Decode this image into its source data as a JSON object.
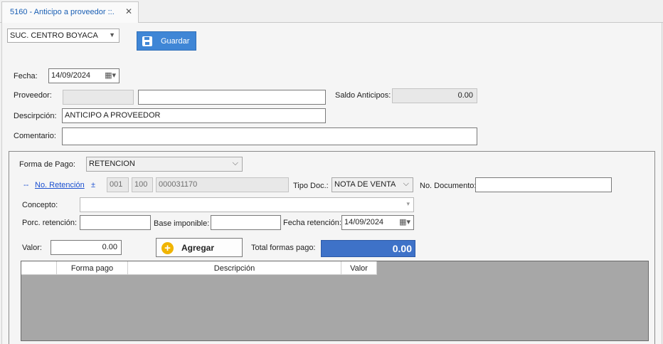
{
  "tab": {
    "title": "5160 - Anticipo a proveedor ::.",
    "close": "✕"
  },
  "branch": {
    "value": "SUC. CENTRO BOYACA"
  },
  "toolbar": {
    "save_label": "Guardar"
  },
  "form": {
    "fecha_label": "Fecha:",
    "fecha_value": "14/09/2024",
    "proveedor_label": "Proveedor:",
    "proveedor_code": "",
    "proveedor_name": "",
    "saldo_label": "Saldo Anticipos:",
    "saldo_value": "0.00",
    "descripcion_label": "Descirpción:",
    "descripcion_value": "ANTICIPO A PROVEEDOR",
    "comentario_label": "Comentario:",
    "comentario_value": ""
  },
  "payment": {
    "forma_label": "Forma de Pago:",
    "forma_value": "RETENCION",
    "collapse_link": "--",
    "no_retencion_link": "No. Retención",
    "plus_link": "±",
    "serie1": "001",
    "serie2": "100",
    "secuencial": "000031170",
    "tipo_doc_label": "Tipo Doc.:",
    "tipo_doc_value": "NOTA DE VENTA",
    "no_documento_label": "No. Documento:",
    "no_documento_value": "",
    "concepto_label": "Concepto:",
    "concepto_value": "",
    "porc_label": "Porc. retención:",
    "porc_value": "",
    "base_label": "Base imponible:",
    "base_value": "",
    "fecha_ret_label": "Fecha retención:",
    "fecha_ret_value": "14/09/2024",
    "valor_label": "Valor:",
    "valor_value": "0.00",
    "add_label": "Agregar",
    "total_label": "Total formas pago:",
    "total_value": "0.00"
  },
  "grid": {
    "columns": [
      "",
      "Forma pago",
      "Descripción",
      "Valor"
    ]
  },
  "colors": {
    "accent": "#3f86d6",
    "total_bg": "#3e72c8",
    "grid_bg": "#a7a7a7",
    "link": "#1a4fd0"
  },
  "icons": {
    "save": "save-icon",
    "add": "add-icon",
    "calendar": "calendar-icon",
    "dropdown": "chevron-down-icon",
    "close": "close-icon"
  }
}
